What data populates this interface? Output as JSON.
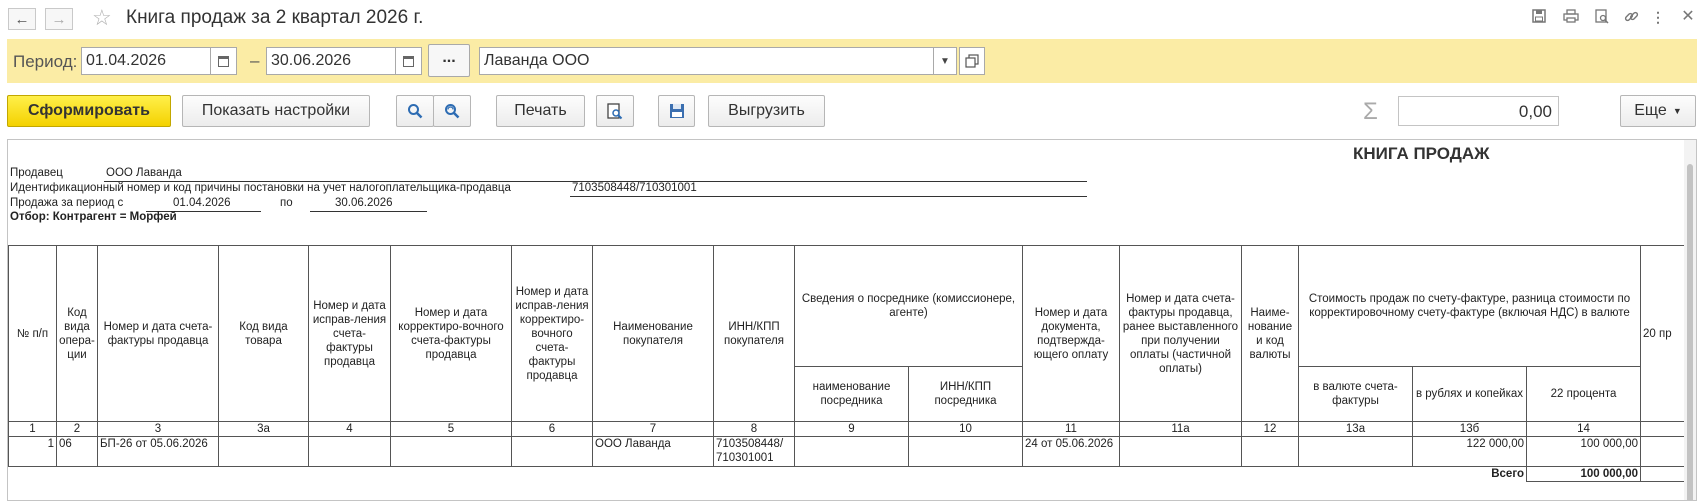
{
  "window": {
    "title": "Книга продаж за 2 квартал 2026 г.",
    "icons": [
      "save-icon",
      "print-icon",
      "preview-icon",
      "link-icon",
      "more-vertical-icon",
      "close-icon"
    ]
  },
  "period": {
    "label": "Период:",
    "from": "01.04.2026",
    "dash": "–",
    "to": "30.06.2026",
    "dots": "...",
    "organization": "Лаванда ООО"
  },
  "toolbar": {
    "generate": "Сформировать",
    "show_settings": "Показать настройки",
    "print": "Печать",
    "export": "Выгрузить",
    "sum_value": "0,00",
    "more": "Еще"
  },
  "report": {
    "title": "КНИГА ПРОДАЖ",
    "seller_label": "Продавец",
    "seller_value": "ООО Лаванда",
    "inn_label": "Идентификационный номер и код причины постановки на учет налогоплательщика-продавца",
    "inn_value": "7103508448/710301001",
    "period_label": "Продажа за период с",
    "period_from": "01.04.2026",
    "period_to_label": "по",
    "period_to": "30.06.2026",
    "filter": "Отбор: Контрагент = Морфей",
    "headers": {
      "c1": "№ п/п",
      "c2": "Код вида опера-ции",
      "c3": "Номер и дата счета-фактуры продавца",
      "c3a": "Код вида товара",
      "c4": "Номер и дата исправ-ления счета-фактуры продавца",
      "c5": "Номер и дата корректиро-вочного счета-фактуры продавца",
      "c6": "Номер и дата исправ-ления корректиро-вочного счета-фактуры продавца",
      "c7": "Наименование покупателя",
      "c8": "ИНН/КПП покупателя",
      "c9_10": "Сведения о посреднике (комиссионере, агенте)",
      "c9": "наименование посредника",
      "c10": "ИНН/КПП посредника",
      "c11": "Номер и дата документа, подтвержда-ющего оплату",
      "c11a": "Номер и дата счета-фактуры продавца, ранее выставленного при получении оплаты (частичной оплаты)",
      "c12": "Наиме-нование и код валюты",
      "c13_14": "Стоимость продаж по счету-фактуре, разница стоимости по корректировочному счету-фактуре (включая НДС) в валюте",
      "c13a": "в валюте счета-фактуры",
      "c13b": "в рублях и копейках",
      "c14": "22 процента",
      "c15": "20 пр"
    },
    "col_numbers": [
      "1",
      "2",
      "3",
      "3а",
      "4",
      "5",
      "6",
      "7",
      "8",
      "9",
      "10",
      "11",
      "11а",
      "12",
      "13а",
      "13б",
      "14",
      ""
    ],
    "rows": [
      {
        "n": "1",
        "code": "06",
        "invoice": "БП-26 от 05.06.2026",
        "goods_code": "",
        "c4": "",
        "c5": "",
        "c6": "",
        "buyer": "ООО Лаванда",
        "buyer_inn": "7103508448/ 710301001",
        "agent": "",
        "agent_inn": "",
        "payment_doc": "24 от 05.06.2026",
        "c11a": "",
        "currency": "",
        "c13a": "",
        "c13b": "122 000,00",
        "c14": "100 000,00",
        "c15": ""
      }
    ],
    "total_label": "Всего",
    "total_c14": "100 000,00"
  }
}
